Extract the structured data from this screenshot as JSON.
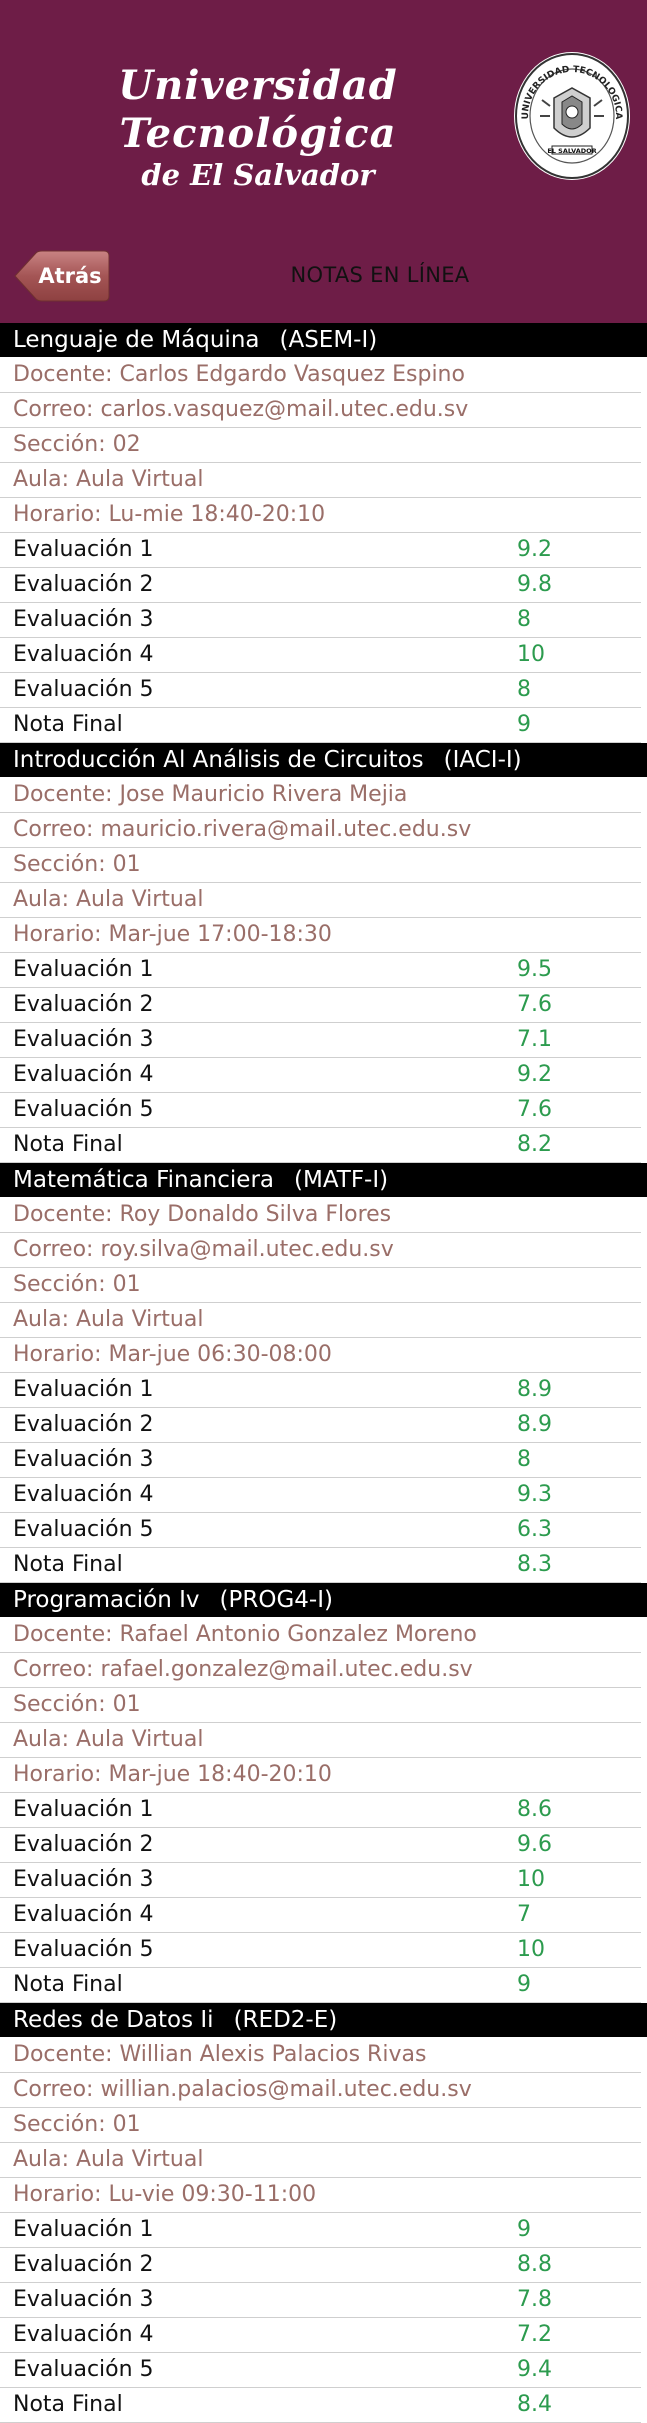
{
  "header": {
    "university_line1": "Universidad Tecnológica",
    "university_line2": "de El Salvador",
    "seal_text_top": "UNIVERSIDAD TECNOLOGICA",
    "seal_text_bottom": "EL SALVADOR",
    "back_label": "Atrás",
    "page_title": "NOTAS EN LÍNEA"
  },
  "colors": {
    "header_bg": "#6e1d47",
    "grade_value": "#2c9b4e",
    "info_text": "#9a6e68"
  },
  "courses": [
    {
      "name": "Lenguaje de Máquina",
      "code": "(ASEM-I)",
      "docente": "Docente: Carlos Edgardo Vasquez Espino",
      "correo": "Correo: carlos.vasquez@mail.utec.edu.sv",
      "seccion": "Sección: 02",
      "aula": "Aula: Aula Virtual",
      "horario": "Horario: Lu-mie 18:40-20:10",
      "grades": [
        {
          "label": "Evaluación 1",
          "value": "9.2"
        },
        {
          "label": "Evaluación 2",
          "value": "9.8"
        },
        {
          "label": "Evaluación 3",
          "value": "8"
        },
        {
          "label": "Evaluación 4",
          "value": "10"
        },
        {
          "label": "Evaluación 5",
          "value": "8"
        },
        {
          "label": "Nota Final",
          "value": "9"
        }
      ]
    },
    {
      "name": "Introducción Al Análisis de Circuitos",
      "code": "(IACI-I)",
      "docente": "Docente: Jose Mauricio Rivera Mejia",
      "correo": "Correo: mauricio.rivera@mail.utec.edu.sv",
      "seccion": "Sección: 01",
      "aula": "Aula: Aula Virtual",
      "horario": "Horario: Mar-jue 17:00-18:30",
      "grades": [
        {
          "label": "Evaluación 1",
          "value": "9.5"
        },
        {
          "label": "Evaluación 2",
          "value": "7.6"
        },
        {
          "label": "Evaluación 3",
          "value": "7.1"
        },
        {
          "label": "Evaluación 4",
          "value": "9.2"
        },
        {
          "label": "Evaluación 5",
          "value": "7.6"
        },
        {
          "label": "Nota Final",
          "value": "8.2"
        }
      ]
    },
    {
      "name": "Matemática Financiera",
      "code": "(MATF-I)",
      "docente": "Docente: Roy Donaldo Silva Flores",
      "correo": "Correo: roy.silva@mail.utec.edu.sv",
      "seccion": "Sección: 01",
      "aula": "Aula: Aula Virtual",
      "horario": "Horario: Mar-jue 06:30-08:00",
      "grades": [
        {
          "label": "Evaluación 1",
          "value": "8.9"
        },
        {
          "label": "Evaluación 2",
          "value": "8.9"
        },
        {
          "label": "Evaluación 3",
          "value": "8"
        },
        {
          "label": "Evaluación 4",
          "value": "9.3"
        },
        {
          "label": "Evaluación 5",
          "value": "6.3"
        },
        {
          "label": "Nota Final",
          "value": "8.3"
        }
      ]
    },
    {
      "name": "Programación Iv",
      "code": "(PROG4-I)",
      "docente": "Docente: Rafael Antonio Gonzalez Moreno",
      "correo": "Correo: rafael.gonzalez@mail.utec.edu.sv",
      "seccion": "Sección: 01",
      "aula": "Aula: Aula Virtual",
      "horario": "Horario: Mar-jue 18:40-20:10",
      "grades": [
        {
          "label": "Evaluación 1",
          "value": "8.6"
        },
        {
          "label": "Evaluación 2",
          "value": "9.6"
        },
        {
          "label": "Evaluación 3",
          "value": "10"
        },
        {
          "label": "Evaluación 4",
          "value": "7"
        },
        {
          "label": "Evaluación 5",
          "value": "10"
        },
        {
          "label": "Nota Final",
          "value": "9"
        }
      ]
    },
    {
      "name": "Redes de Datos Ii",
      "code": "(RED2-E)",
      "docente": "Docente: Willian Alexis Palacios Rivas",
      "correo": "Correo: willian.palacios@mail.utec.edu.sv",
      "seccion": "Sección: 01",
      "aula": "Aula: Aula Virtual",
      "horario": "Horario: Lu-vie 09:30-11:00",
      "grades": [
        {
          "label": "Evaluación 1",
          "value": "9"
        },
        {
          "label": "Evaluación 2",
          "value": "8.8"
        },
        {
          "label": "Evaluación 3",
          "value": "7.8"
        },
        {
          "label": "Evaluación 4",
          "value": "7.2"
        },
        {
          "label": "Evaluación 5",
          "value": "9.4"
        },
        {
          "label": "Nota Final",
          "value": "8.4"
        }
      ]
    }
  ]
}
